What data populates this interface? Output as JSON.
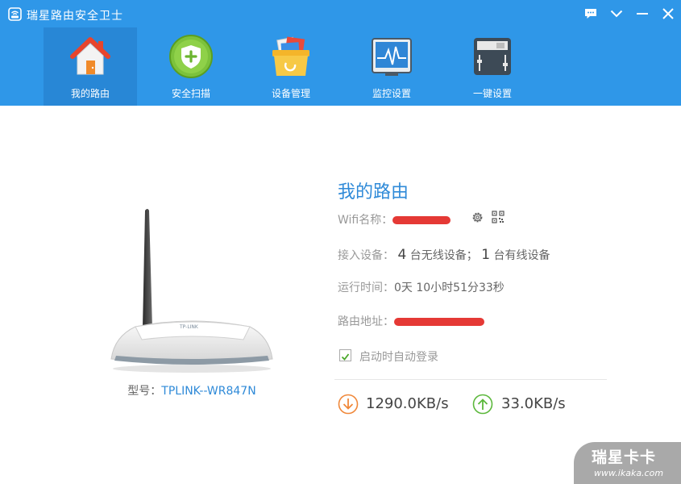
{
  "app": {
    "title": "瑞星路由安全卫士"
  },
  "window_controls": {
    "feedback": "message-icon",
    "minimize": "chevron-down-icon",
    "maximize": "minimize-icon",
    "close": "close-icon"
  },
  "nav": {
    "items": [
      {
        "label": "我的路由",
        "icon": "home-icon",
        "active": true
      },
      {
        "label": "安全扫描",
        "icon": "shield-icon",
        "active": false
      },
      {
        "label": "设备管理",
        "icon": "device-box-icon",
        "active": false
      },
      {
        "label": "监控设置",
        "icon": "monitor-icon",
        "active": false
      },
      {
        "label": "一键设置",
        "icon": "settings-panel-icon",
        "active": false
      }
    ]
  },
  "router": {
    "model_prefix": "型号：",
    "model_value": "TPLINK--WR847N",
    "brand_label": "TP-LINK"
  },
  "info": {
    "title": "我的路由",
    "wifi_label": "Wifi名称：",
    "devices_label": "接入设备：",
    "wireless_count": "4",
    "wireless_text": "台无线设备；",
    "wired_count": "1",
    "wired_text": "台有线设备",
    "uptime_label": "运行时间：",
    "uptime_value": "0天 10小时51分33秒",
    "address_label": "路由地址：",
    "auto_login_label": "启动时自动登录",
    "auto_login_checked": true
  },
  "speed": {
    "download": "1290.0KB/s",
    "upload": "33.0KB/s"
  },
  "watermark": {
    "title": "瑞星卡卡",
    "url": "www.ikaka.com"
  },
  "colors": {
    "header_bg": "#2f97e8",
    "active_tab": "#2887d6",
    "accent": "#2f8ad8",
    "download": "#f0883a",
    "upload": "#5cb83c",
    "redaction": "#e53935"
  }
}
